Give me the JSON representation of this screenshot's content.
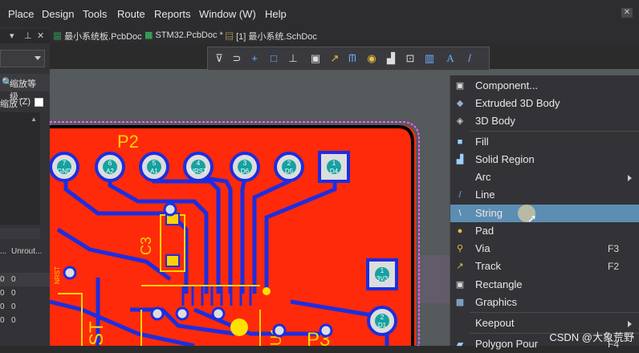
{
  "menubar": {
    "items": [
      "Place",
      "Design",
      "Tools",
      "Route",
      "Reports",
      "Window (W)",
      "Help"
    ]
  },
  "left_panel": {
    "zoom_button": "缩放等级...",
    "zoom_label": "缩放",
    "zoom_key": "(Z)",
    "table_headers": [
      "...",
      "Unrout..."
    ],
    "table_rows": [
      [
        "0",
        "0"
      ],
      [
        "0",
        "0"
      ],
      [
        "0",
        "0"
      ],
      [
        "0",
        "0"
      ]
    ]
  },
  "tabs": [
    {
      "label": "最小系统板.PcbDoc",
      "active": true
    },
    {
      "label": "STM32.PcbDoc *",
      "active": false
    },
    {
      "label": "[1] 最小系统.SchDoc",
      "active": false
    }
  ],
  "toolbar": {
    "icons": [
      "select-filter-icon",
      "interactive-route-icon",
      "crosshair-icon",
      "rectangle-select-icon",
      "align-icon",
      "component-icon",
      "drill-icon",
      "arc-icon",
      "fill-icon",
      "region-icon",
      "keepout-icon",
      "dimension-icon",
      "string-icon",
      "line-icon"
    ]
  },
  "pcb": {
    "designator_p2": "P2",
    "designator_p3": "P3",
    "designator_c3": "C3",
    "designator_u1": "U1",
    "designator_st": "ST",
    "label_nrst": "NRST",
    "pads_top": [
      {
        "num": "7",
        "net": "GND"
      },
      {
        "num": "6",
        "net": "A2"
      },
      {
        "num": "5",
        "net": "A1"
      },
      {
        "num": "4",
        "net": "NRST"
      },
      {
        "num": "3",
        "net": "D6"
      },
      {
        "num": "2",
        "net": "D5"
      },
      {
        "num": "1",
        "net": "D4"
      }
    ],
    "pad_right_square": {
      "num": "1",
      "net": "3V3"
    },
    "pad_right_round": {
      "num": "2",
      "net": "D1"
    }
  },
  "context_menu": {
    "items": [
      {
        "label": "Component...",
        "shortcut": "",
        "submenu": false,
        "icon": "component-icon",
        "highlight": false
      },
      {
        "label": "Extruded 3D Body",
        "shortcut": "",
        "submenu": false,
        "icon": "extruded-body-icon",
        "highlight": false
      },
      {
        "label": "3D Body",
        "shortcut": "",
        "submenu": false,
        "icon": "3d-body-icon",
        "highlight": false
      },
      {
        "label": "Fill",
        "shortcut": "",
        "submenu": false,
        "icon": "fill-icon",
        "highlight": false
      },
      {
        "label": "Solid Region",
        "shortcut": "",
        "submenu": false,
        "icon": "solid-region-icon",
        "highlight": false
      },
      {
        "label": "Arc",
        "shortcut": "",
        "submenu": true,
        "icon": "arc-icon",
        "highlight": false
      },
      {
        "label": "Line",
        "shortcut": "",
        "submenu": false,
        "icon": "line-icon",
        "highlight": false
      },
      {
        "label": "String",
        "shortcut": "",
        "submenu": false,
        "icon": "string-icon",
        "highlight": true
      },
      {
        "label": "Pad",
        "shortcut": "",
        "submenu": false,
        "icon": "pad-icon",
        "highlight": false
      },
      {
        "label": "Via",
        "shortcut": "F3",
        "submenu": false,
        "icon": "via-icon",
        "highlight": false
      },
      {
        "label": "Track",
        "shortcut": "F2",
        "submenu": false,
        "icon": "track-icon",
        "highlight": false
      },
      {
        "label": "Rectangle",
        "shortcut": "",
        "submenu": false,
        "icon": "rectangle-icon",
        "highlight": false
      },
      {
        "label": "Graphics",
        "shortcut": "",
        "submenu": false,
        "icon": "graphics-icon",
        "highlight": false
      },
      {
        "label": "Keepout",
        "shortcut": "",
        "submenu": true,
        "icon": "keepout-icon",
        "highlight": false
      },
      {
        "label": "Polygon Pour",
        "shortcut": "F4",
        "submenu": false,
        "icon": "polygon-pour-icon",
        "highlight": false
      }
    ]
  },
  "watermark": "CSDN @大象荒野",
  "colors": {
    "board": "#ff2a0a",
    "trace": "#1c2ee0",
    "silkscreen": "#ffd400",
    "menu_highlight": "#5c8db3",
    "board_outline": "#ff5cff"
  }
}
